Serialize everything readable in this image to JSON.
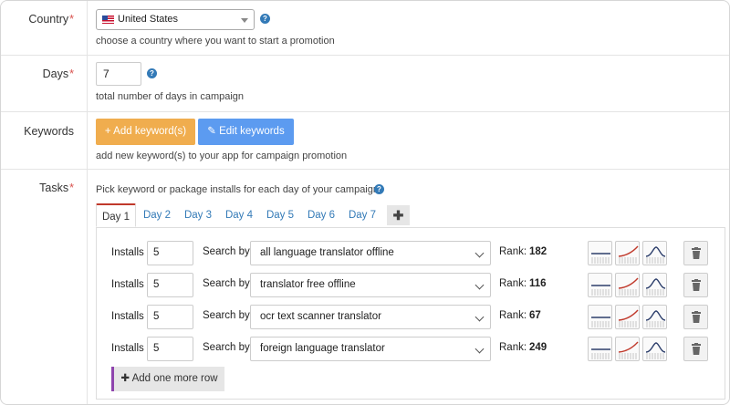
{
  "country": {
    "label": "Country",
    "required_mark": "*",
    "selected": "United States",
    "hint": "choose a country where you want to start a promotion"
  },
  "days": {
    "label": "Days",
    "required_mark": "*",
    "value": "7",
    "hint": "total number of days in campaign"
  },
  "keywords": {
    "label": "Keywords",
    "add_button": "+ Add keyword(s)",
    "edit_button": "✎ Edit keywords",
    "hint": "add new keyword(s) to your app for campaign promotion"
  },
  "tasks": {
    "label": "Tasks",
    "required_mark": "*",
    "hint": "Pick keyword or package installs for each day of your campaign",
    "tabs": [
      "Day 1",
      "Day 2",
      "Day 3",
      "Day 4",
      "Day 5",
      "Day 6",
      "Day 7"
    ],
    "active_tab": "Day 1",
    "add_tab": "✚",
    "installs_label": "Installs",
    "search_by_label": "Search by",
    "rank_label": "Rank:",
    "rows": [
      {
        "installs": "5",
        "keyword": "all language translator offline",
        "rank": "182"
      },
      {
        "installs": "5",
        "keyword": "translator free offline",
        "rank": "116"
      },
      {
        "installs": "5",
        "keyword": "ocr text scanner translator",
        "rank": "67"
      },
      {
        "installs": "5",
        "keyword": "foreign language translator",
        "rank": "249"
      }
    ],
    "trend_icons": [
      "flat-trend-icon",
      "rising-trend-icon",
      "peak-trend-icon"
    ],
    "add_row_button": "✚ Add one more row"
  },
  "colors": {
    "required": "#d9534f",
    "add_keyword_button": "#f0ad4e",
    "edit_keyword_button": "#5c9bf0",
    "link": "#337ab7",
    "active_tab_border": "#c0392b",
    "trend_line_red": "#c0392b",
    "trend_line_navy": "#2c3e6b",
    "add_row_accent": "#8e44ad"
  }
}
